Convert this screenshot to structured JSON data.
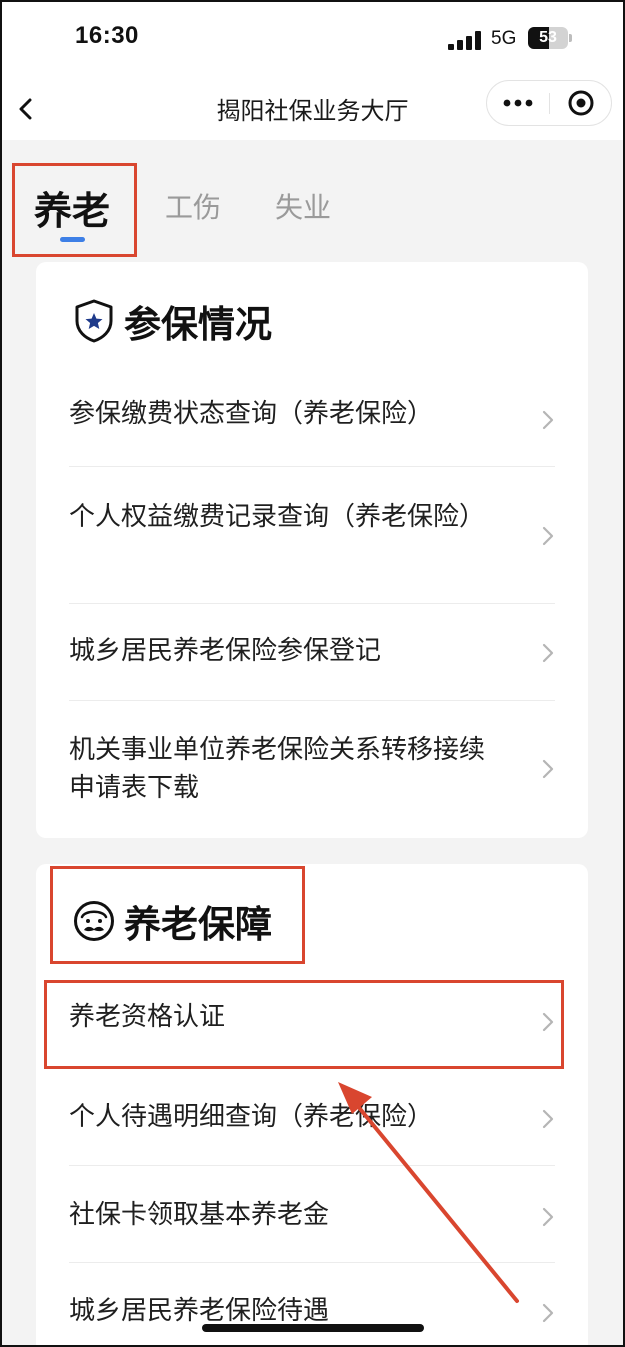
{
  "status_bar": {
    "time": "16:30",
    "network": "5G",
    "battery_level": "53",
    "battery_fraction": 0.53
  },
  "nav": {
    "title": "揭阳社保业务大厅",
    "back_icon": "chevron-left-icon",
    "more_icon": "more-dots-icon",
    "close_icon": "target-circle-icon"
  },
  "tabs": [
    {
      "label": "养老",
      "active": true
    },
    {
      "label": "工伤",
      "active": false
    },
    {
      "label": "失业",
      "active": false
    }
  ],
  "sections": [
    {
      "title": "参保情况",
      "icon": "shield-star-icon",
      "items": [
        {
          "label": "参保缴费状态查询（养老保险）"
        },
        {
          "label": "个人权益缴费记录查询（养老保险）"
        },
        {
          "label": "城乡居民养老保险参保登记"
        },
        {
          "label": "机关事业单位养老保险关系转移接续申请表下载"
        }
      ]
    },
    {
      "title": "养老保障",
      "icon": "elder-face-icon",
      "items": [
        {
          "label": "养老资格认证"
        },
        {
          "label": "个人待遇明细查询（养老保险）"
        },
        {
          "label": "社保卡领取基本养老金"
        },
        {
          "label": "城乡居民养老保险待遇"
        }
      ]
    }
  ],
  "colors": {
    "annotation": "#d9462f",
    "tab_indicator": "#3d7fe6",
    "page_background": "#f3f3f3"
  }
}
